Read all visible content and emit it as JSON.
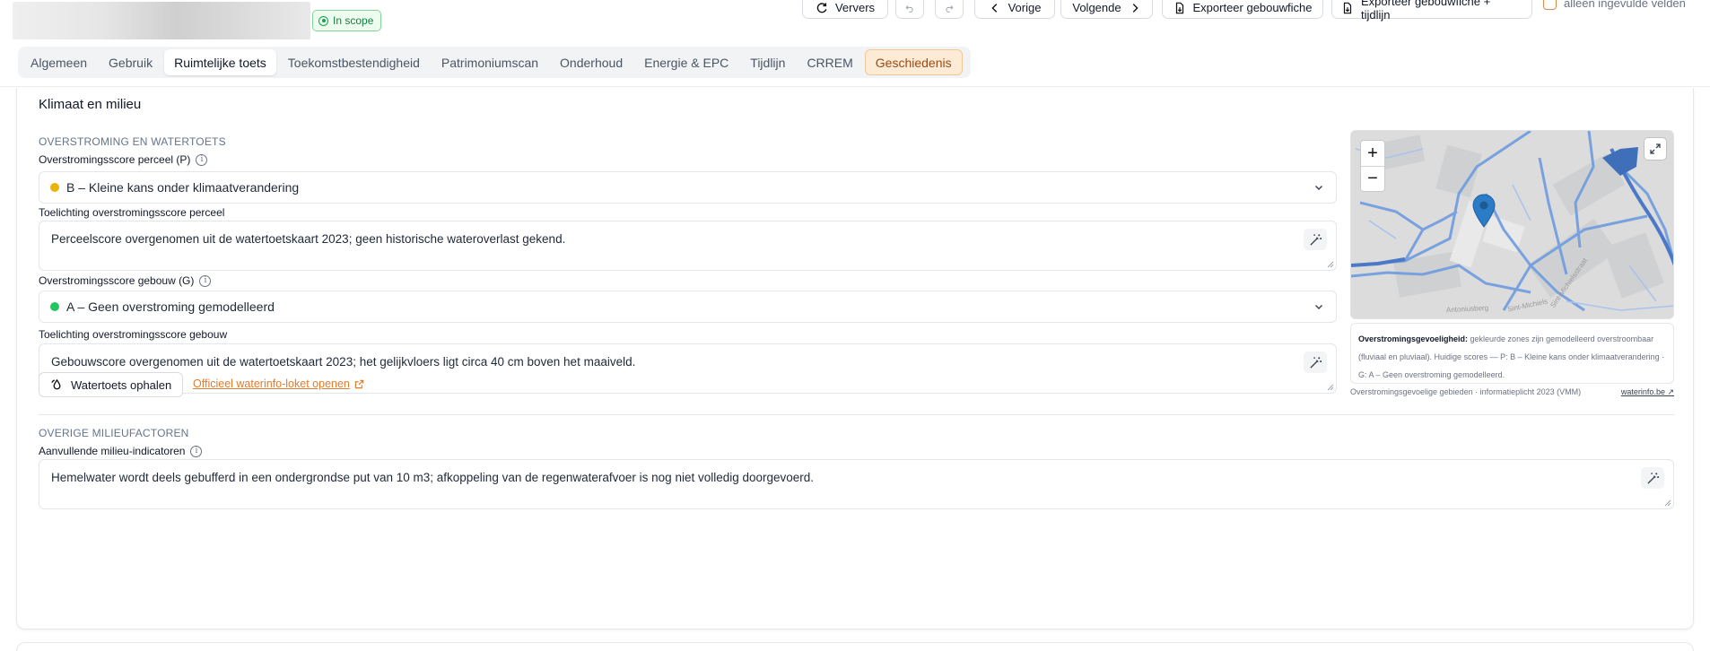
{
  "header": {
    "scope_badge": "In scope",
    "buttons": {
      "refresh": "Ververs",
      "previous": "Vorige",
      "next": "Volgende",
      "export_sheet": "Exporteer gebouwfiche",
      "export_sheet_timeline": "Exporteer gebouwfiche + tijdlijn"
    },
    "only_filled_label": "alleen ingevulde velden"
  },
  "tabs": [
    {
      "label": "Algemeen"
    },
    {
      "label": "Gebruik"
    },
    {
      "label": "Ruimtelijke toets"
    },
    {
      "label": "Toekomstbestendigheid"
    },
    {
      "label": "Patrimoniumscan"
    },
    {
      "label": "Onderhoud"
    },
    {
      "label": "Energie & EPC"
    },
    {
      "label": "Tijdlijn"
    },
    {
      "label": "CRREM"
    },
    {
      "label": "Geschiedenis"
    }
  ],
  "active_tab": "Ruimtelijke toets",
  "card": {
    "title": "Klimaat en milieu",
    "flood_section": {
      "heading": "OVERSTROMING EN WATERTOETS",
      "parcel_score_label": "Overstromingsscore perceel (P)",
      "parcel_score_value": "B – Kleine kans onder klimaatverandering",
      "parcel_score_color": "#eab308",
      "parcel_note_label": "Toelichting overstromingsscore perceel",
      "parcel_note_value": "Perceelscore overgenomen uit de watertoetskaart 2023; geen historische wateroverlast gekend.",
      "building_score_label": "Overstromingsscore gebouw (G)",
      "building_score_value": "A – Geen overstroming gemodelleerd",
      "building_score_color": "#22c55e",
      "building_note_label": "Toelichting overstromingsscore gebouw",
      "building_note_value": "Gebouwscore overgenomen uit de watertoetskaart 2023; het gelijkvloers ligt circa 40 cm boven het maaiveld.",
      "fetch_button": "Watertoets ophalen",
      "external_link": "Officieel waterinfo-loket openen"
    },
    "map": {
      "zoom_in": "+",
      "zoom_out": "−",
      "street_1": "Sint-Michielsstraat",
      "street_2": "Antoniusberg",
      "street_3": "Sint-Michiels",
      "legend_title": "Overstromingsgevoeligheid:",
      "legend_text": " gekleurde zones zijn gemodelleerd overstroombaar (fluviaal en pluviaal). Huidige scores — P: B – Kleine kans onder klimaatverandering · G: A – Geen overstroming gemodelleerd.",
      "source": "Overstromingsgevoelige gebieden · informatieplicht 2023 (VMM)",
      "source_link": "waterinfo.be ↗"
    },
    "other_section": {
      "heading": "OVERIGE MILIEUFACTOREN",
      "indicators_label": "Aanvullende milieu-indicatoren",
      "indicators_value": "Hemelwater wordt deels gebufferd in een ondergrondse put van 10 m3; afkoppeling van de regenwaterafvoer is nog niet volledig doorgevoerd."
    }
  },
  "colors": {
    "accent_orange": "#e07b2c",
    "flood_blue": "#3b82f6",
    "in_scope_green": "#16a34a"
  }
}
